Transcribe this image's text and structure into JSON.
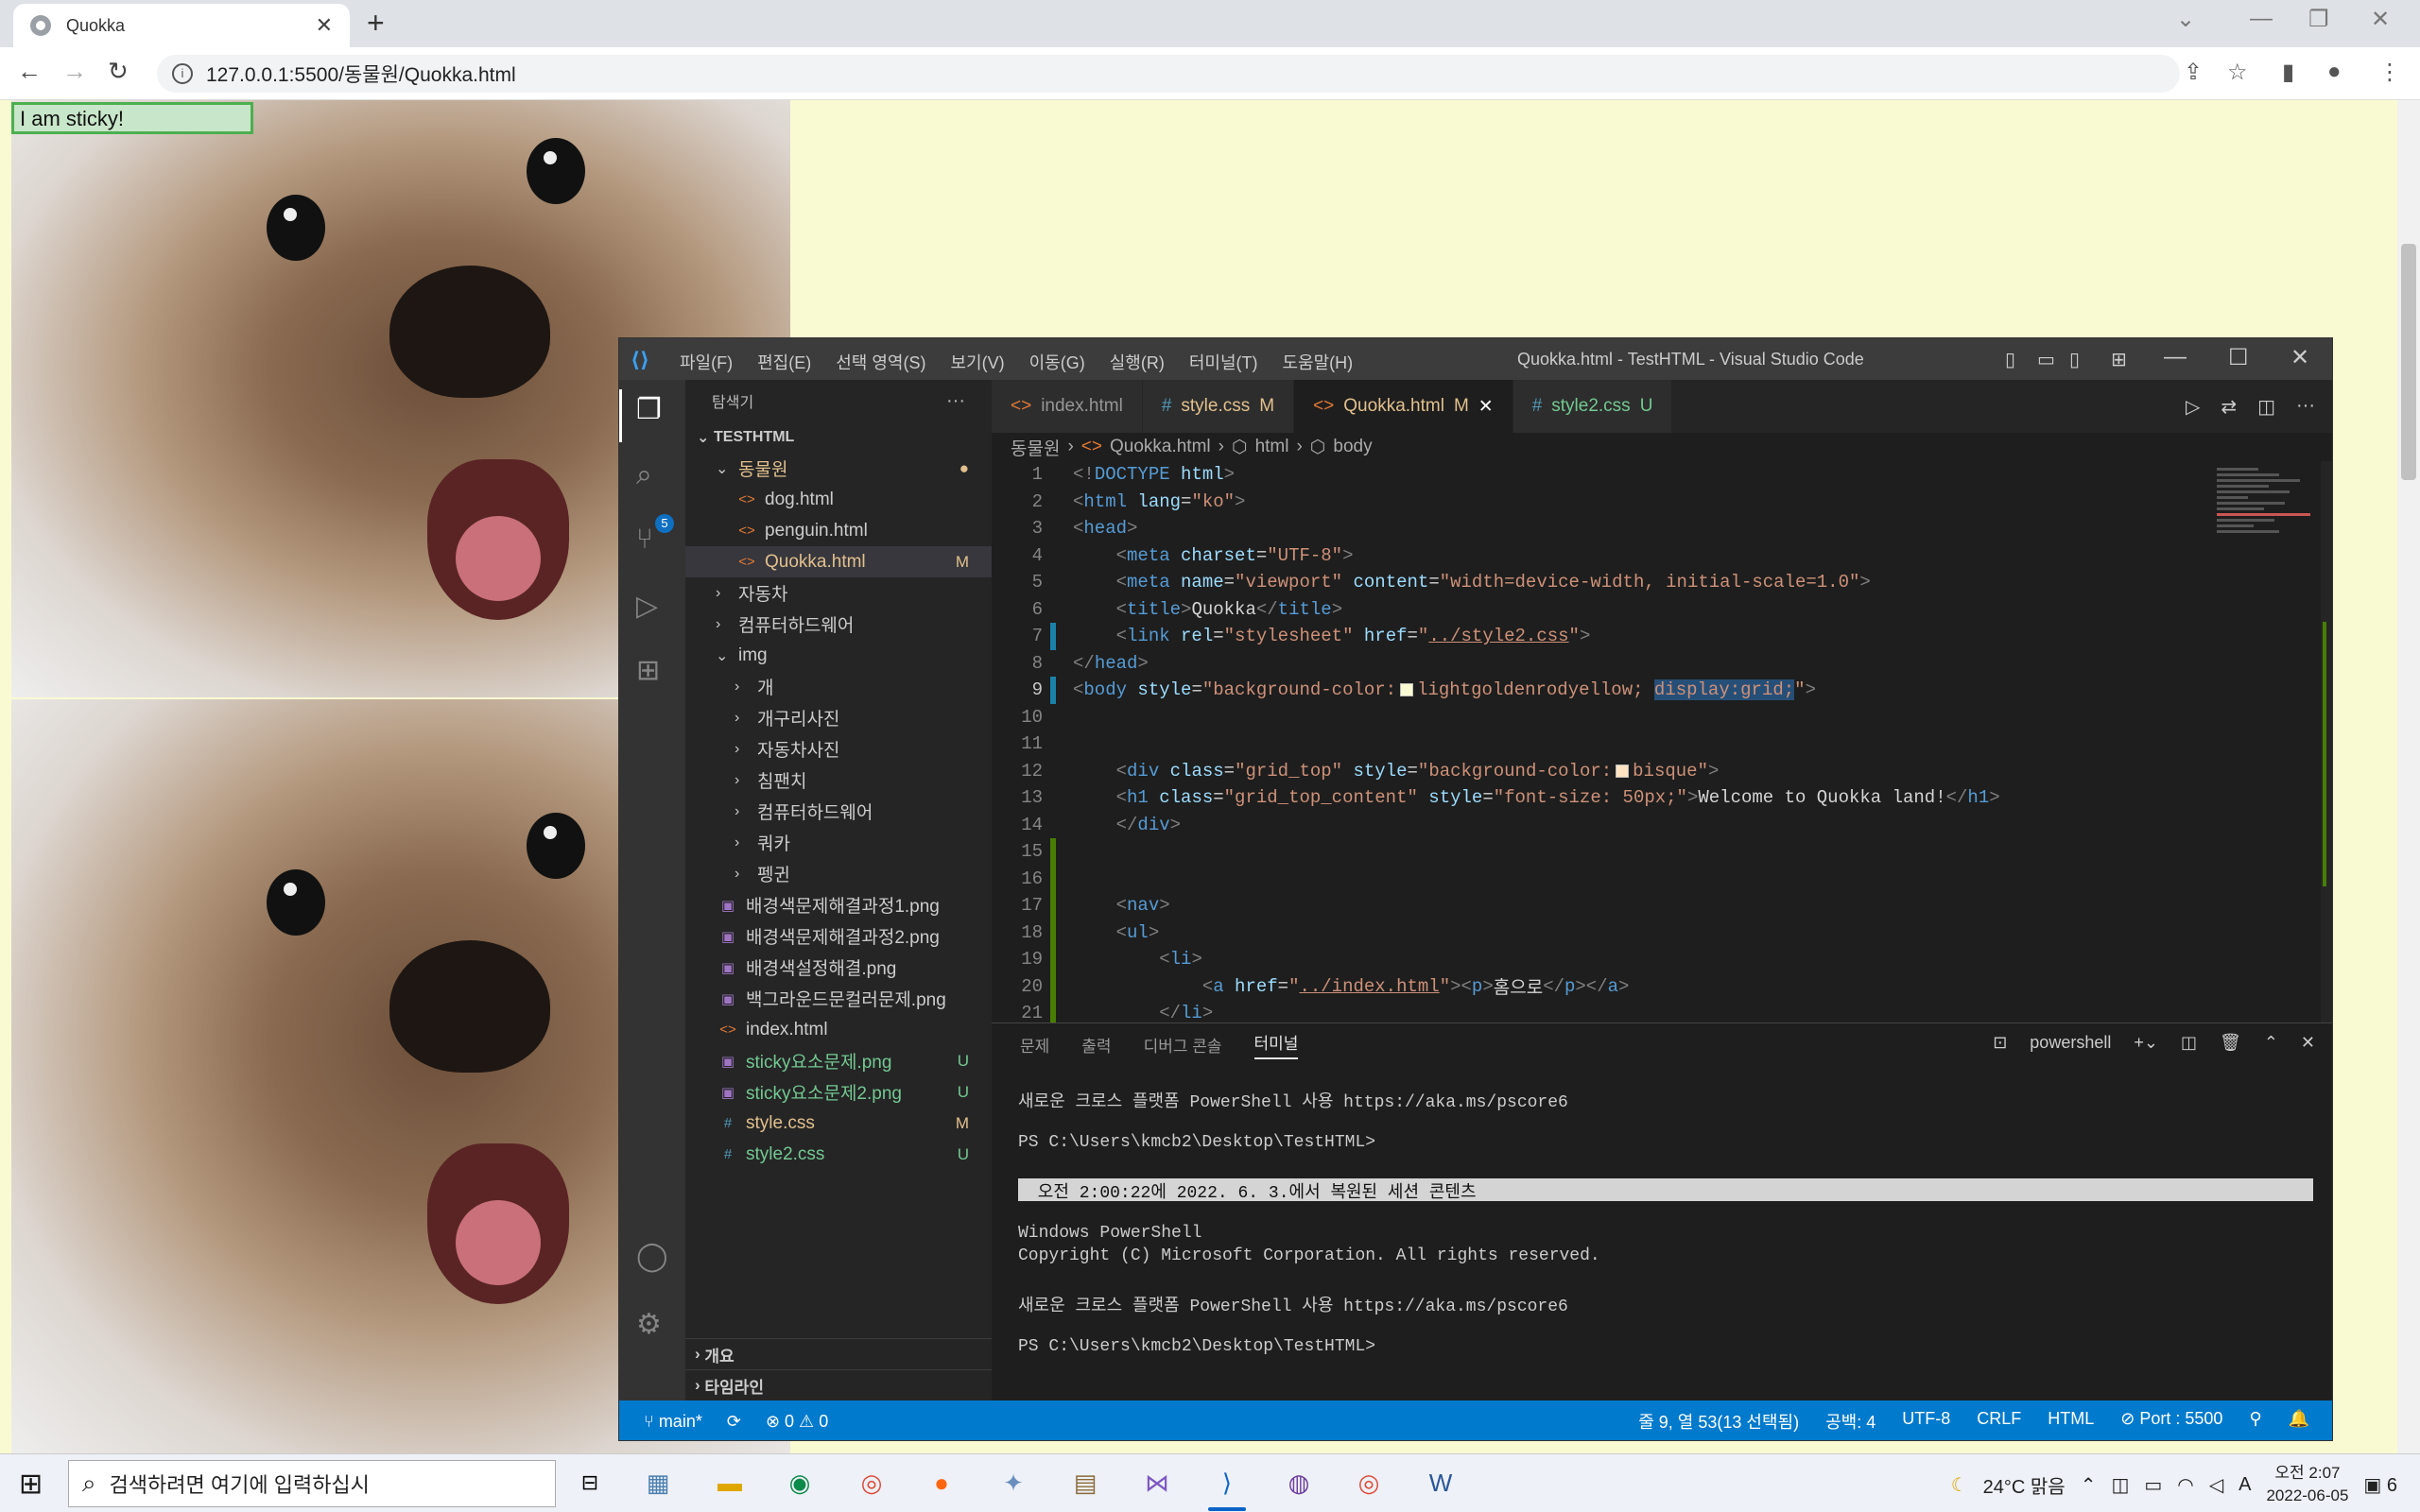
{
  "browser": {
    "tab_title": "Quokka",
    "url": "127.0.0.1:5500/동물원/Quokka.html"
  },
  "page": {
    "sticky_text": "I am sticky!"
  },
  "vscode": {
    "menu": [
      "파일(F)",
      "편집(E)",
      "선택 영역(S)",
      "보기(V)",
      "이동(G)",
      "실행(R)",
      "터미널(T)",
      "도움말(H)"
    ],
    "window_title": "Quokka.html - TestHTML - Visual Studio Code",
    "scm_badge": "5",
    "explorer": {
      "title": "탐색기",
      "root": "TESTHTML",
      "rows": [
        {
          "label": "동물원",
          "type": "folder-open",
          "indent": 1,
          "color": "mod",
          "badge": "●"
        },
        {
          "label": "dog.html",
          "type": "html",
          "indent": 2
        },
        {
          "label": "penguin.html",
          "type": "html",
          "indent": 2
        },
        {
          "label": "Quokka.html",
          "type": "html",
          "indent": 2,
          "color": "mod",
          "badge": "M",
          "selected": true
        },
        {
          "label": "자동차",
          "type": "folder",
          "indent": 1
        },
        {
          "label": "컴퓨터하드웨어",
          "type": "folder",
          "indent": 1
        },
        {
          "label": "img",
          "type": "folder-open",
          "indent": 1
        },
        {
          "label": "개",
          "type": "folder",
          "indent": 2
        },
        {
          "label": "개구리사진",
          "type": "folder",
          "indent": 2
        },
        {
          "label": "자동차사진",
          "type": "folder",
          "indent": 2
        },
        {
          "label": "침팬치",
          "type": "folder",
          "indent": 2
        },
        {
          "label": "컴퓨터하드웨어",
          "type": "folder",
          "indent": 2
        },
        {
          "label": "쿼카",
          "type": "folder",
          "indent": 2
        },
        {
          "label": "펭귄",
          "type": "folder",
          "indent": 2
        },
        {
          "label": "배경색문제해결과정1.png",
          "type": "png",
          "indent": 1
        },
        {
          "label": "배경색문제해결과정2.png",
          "type": "png",
          "indent": 1
        },
        {
          "label": "배경색설정해결.png",
          "type": "png",
          "indent": 1
        },
        {
          "label": "백그라운드문컬러문제.png",
          "type": "png",
          "indent": 1
        },
        {
          "label": "index.html",
          "type": "html",
          "indent": 1
        },
        {
          "label": "sticky요소문제.png",
          "type": "png",
          "indent": 1,
          "color": "unt",
          "badge": "U"
        },
        {
          "label": "sticky요소문제2.png",
          "type": "png",
          "indent": 1,
          "color": "unt",
          "badge": "U"
        },
        {
          "label": "style.css",
          "type": "css",
          "indent": 1,
          "color": "mod",
          "badge": "M"
        },
        {
          "label": "style2.css",
          "type": "css",
          "indent": 1,
          "color": "unt",
          "badge": "U"
        }
      ],
      "outline": "개요",
      "timeline": "타임라인"
    },
    "tabs": [
      {
        "icon": "<>",
        "label": "index.html",
        "state": ""
      },
      {
        "icon": "#",
        "label": "style.css",
        "state": "M"
      },
      {
        "icon": "<>",
        "label": "Quokka.html",
        "state": "M",
        "active": true
      },
      {
        "icon": "#",
        "label": "style2.css",
        "state": "U"
      }
    ],
    "breadcrumb": [
      "동물원",
      "Quokka.html",
      "html",
      "body"
    ],
    "panel": {
      "tabs": [
        "문제",
        "출력",
        "디버그 콘솔",
        "터미널"
      ],
      "shell": "powershell"
    },
    "terminal": [
      "새로운 크로스 플랫폼 PowerShell 사용 https://aka.ms/pscore6",
      "",
      "PS C:\\Users\\kmcb2\\Desktop\\TestHTML>",
      "",
      " 오전 2:00:22에 2022. 6. 3.에서 복원된 세션 콘텐츠",
      "",
      "Windows PowerShell",
      "Copyright (C) Microsoft Corporation. All rights reserved.",
      "",
      "새로운 크로스 플랫폼 PowerShell 사용 https://aka.ms/pscore6",
      "",
      "PS C:\\Users\\kmcb2\\Desktop\\TestHTML>"
    ],
    "status": {
      "branch": "main*",
      "errors": "0",
      "warnings": "0",
      "cursor": "줄 9, 열 53(13 선택됨)",
      "spaces": "공백: 4",
      "encoding": "UTF-8",
      "eol": "CRLF",
      "language": "HTML",
      "port": "Port : 5500"
    }
  },
  "taskbar": {
    "search_placeholder": "검색하려면 여기에 입력하십시",
    "weather": "24°C 맑음",
    "ime": "A",
    "time": "오전 2:07",
    "date": "2022-06-05",
    "notifications": "6"
  }
}
